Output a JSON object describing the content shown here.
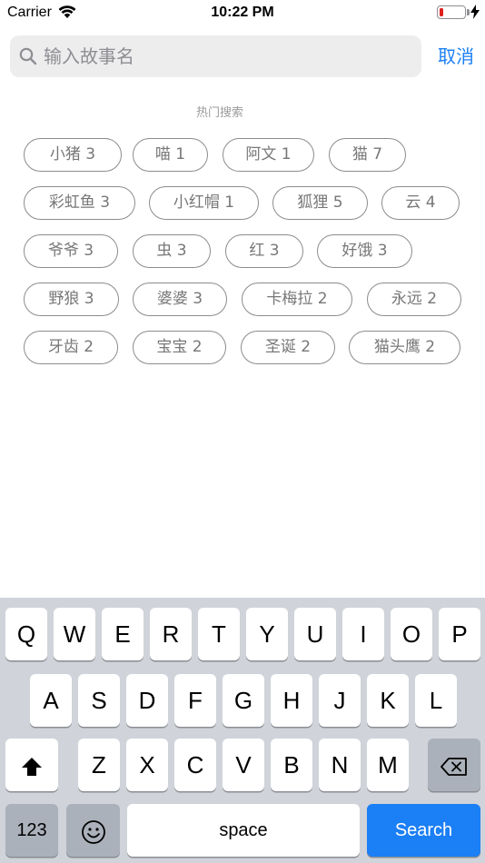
{
  "status_bar": {
    "carrier": "Carrier",
    "time": "10:22 PM",
    "battery_level": 0.12,
    "battery_color": "#e02020",
    "icons": [
      "wifi-icon",
      "battery-icon",
      "charging-bolt-icon"
    ]
  },
  "search": {
    "placeholder": "输入故事名",
    "value": "",
    "cancel_label": "取消",
    "accent_color": "#1b7ff5"
  },
  "hot_search": {
    "title": "热门搜索",
    "tags": [
      "小猪 3",
      "喵 1",
      "阿文 1",
      "猫 7",
      "彩虹鱼 3",
      "小红帽 1",
      "狐狸 5",
      "云 4",
      "爷爷 3",
      "虫 3",
      "红 3",
      "好饿 3",
      "野狼 3",
      "婆婆 3",
      "卡梅拉 2",
      "永远 2",
      "牙齿 2",
      "宝宝 2",
      "圣诞 2",
      "猫头鹰 2"
    ]
  },
  "keyboard": {
    "rows": [
      [
        "Q",
        "W",
        "E",
        "R",
        "T",
        "Y",
        "U",
        "I",
        "O",
        "P"
      ],
      [
        "A",
        "S",
        "D",
        "F",
        "G",
        "H",
        "J",
        "K",
        "L"
      ],
      [
        "Z",
        "X",
        "C",
        "V",
        "B",
        "N",
        "M"
      ]
    ],
    "numbers_label": "123",
    "space_label": "space",
    "search_label": "Search",
    "special_icons": [
      "shift-icon",
      "backspace-icon",
      "emoji-icon"
    ]
  }
}
